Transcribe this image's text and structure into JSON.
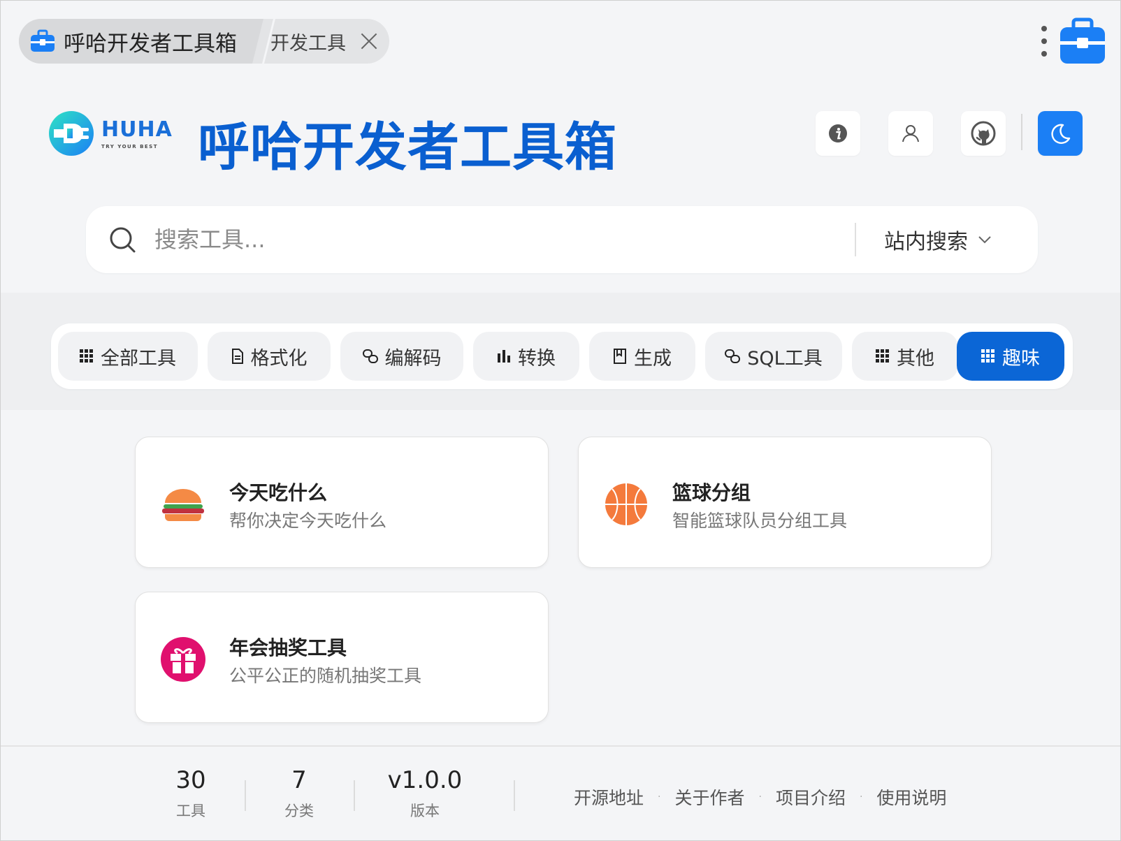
{
  "tabs": [
    {
      "label": "呼哈开发者工具箱",
      "icon": "toolbox-icon",
      "active": true
    },
    {
      "label": "开发工具",
      "active": false
    }
  ],
  "header": {
    "logo_text": "HUHA",
    "logo_tagline": "TRY YOUR BEST",
    "title": "呼哈开发者工具箱",
    "buttons": [
      "info-icon",
      "user-icon",
      "github-icon",
      "moon-icon"
    ]
  },
  "search": {
    "placeholder": "搜索工具...",
    "scope": "站内搜索"
  },
  "categories": [
    {
      "label": "全部工具",
      "icon": "grid-icon"
    },
    {
      "label": "格式化",
      "icon": "document-icon"
    },
    {
      "label": "编解码",
      "icon": "link-icon"
    },
    {
      "label": "转换",
      "icon": "bar-chart-icon"
    },
    {
      "label": "生成",
      "icon": "book-icon"
    },
    {
      "label": "SQL工具",
      "icon": "link-icon"
    },
    {
      "label": "其他",
      "icon": "grid-icon"
    },
    {
      "label": "趣味",
      "icon": "grid-icon",
      "active": true
    }
  ],
  "tools": [
    {
      "title": "今天吃什么",
      "desc": "帮你决定今天吃什么",
      "icon": "hamburger-icon"
    },
    {
      "title": "篮球分组",
      "desc": "智能篮球队员分组工具",
      "icon": "basketball-icon"
    },
    {
      "title": "年会抽奖工具",
      "desc": "公平公正的随机抽奖工具",
      "icon": "gift-icon"
    }
  ],
  "footer": {
    "stats": [
      {
        "num": "30",
        "label": "工具"
      },
      {
        "num": "7",
        "label": "分类"
      },
      {
        "num": "v1.0.0",
        "label": "版本"
      }
    ],
    "links": [
      "开源地址",
      "关于作者",
      "项目介绍",
      "使用说明"
    ]
  },
  "colors": {
    "accent": "#0b66d6",
    "theme_button": "#1b7ff5",
    "title": "#0a5fd0",
    "gift": "#e0106e",
    "basketball": "#f47a3c"
  }
}
